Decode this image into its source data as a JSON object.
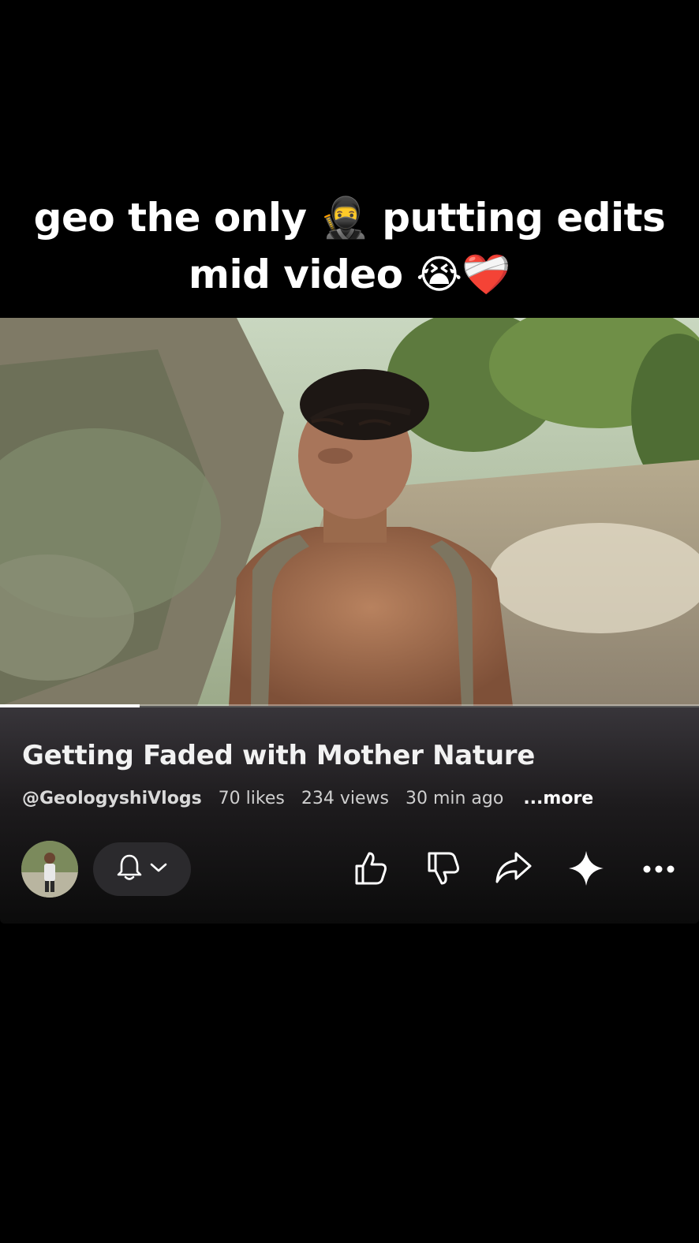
{
  "caption": {
    "line1": "geo the only 🥷 putting edits",
    "line2": "mid video 😭❤️‍🩹"
  },
  "video": {
    "title": "Getting Faded with Mother Nature",
    "channel": "@GeologyshiVlogs",
    "likes": "70 likes",
    "views": "234 views",
    "time": "30 min ago",
    "more": "...more",
    "progress": 0.2
  },
  "actions": {
    "avatar_icon": "channel-avatar",
    "bell_icon": "bell-icon",
    "chevron_icon": "chevron-down-icon",
    "like_icon": "thumbs-up-icon",
    "dislike_icon": "thumbs-down-icon",
    "share_icon": "share-icon",
    "ai_icon": "sparkle-icon",
    "menu_icon": "more-icon"
  },
  "colors": {
    "background": "#000000",
    "panel_top": "#38353a",
    "text": "#ffffff",
    "meta": "#cfcfcf"
  }
}
